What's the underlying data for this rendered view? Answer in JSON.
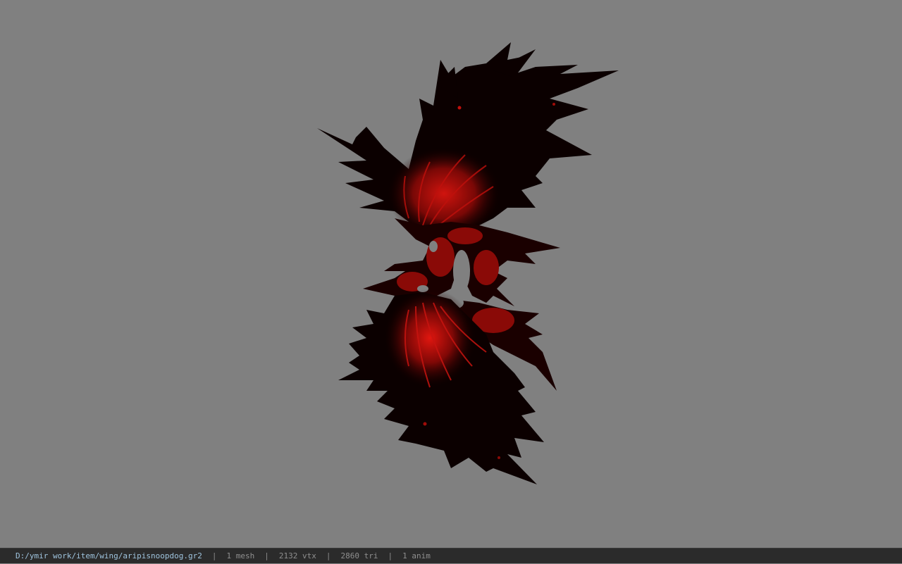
{
  "viewer": {
    "background_color": "#808080",
    "model_name": "aripisnoopdog",
    "model_colors": {
      "dark": "#0a0000",
      "red": "#c0100c",
      "accent": "#ff2a1a"
    }
  },
  "status_bar": {
    "file_path": "D:/ymir work/item/wing/aripisnoopdog.gr2",
    "separator": "|",
    "mesh_count": "1 mesh",
    "vertex_count": "2132 vtx",
    "triangle_count": "2860 tri",
    "anim_count": "1 anim"
  }
}
